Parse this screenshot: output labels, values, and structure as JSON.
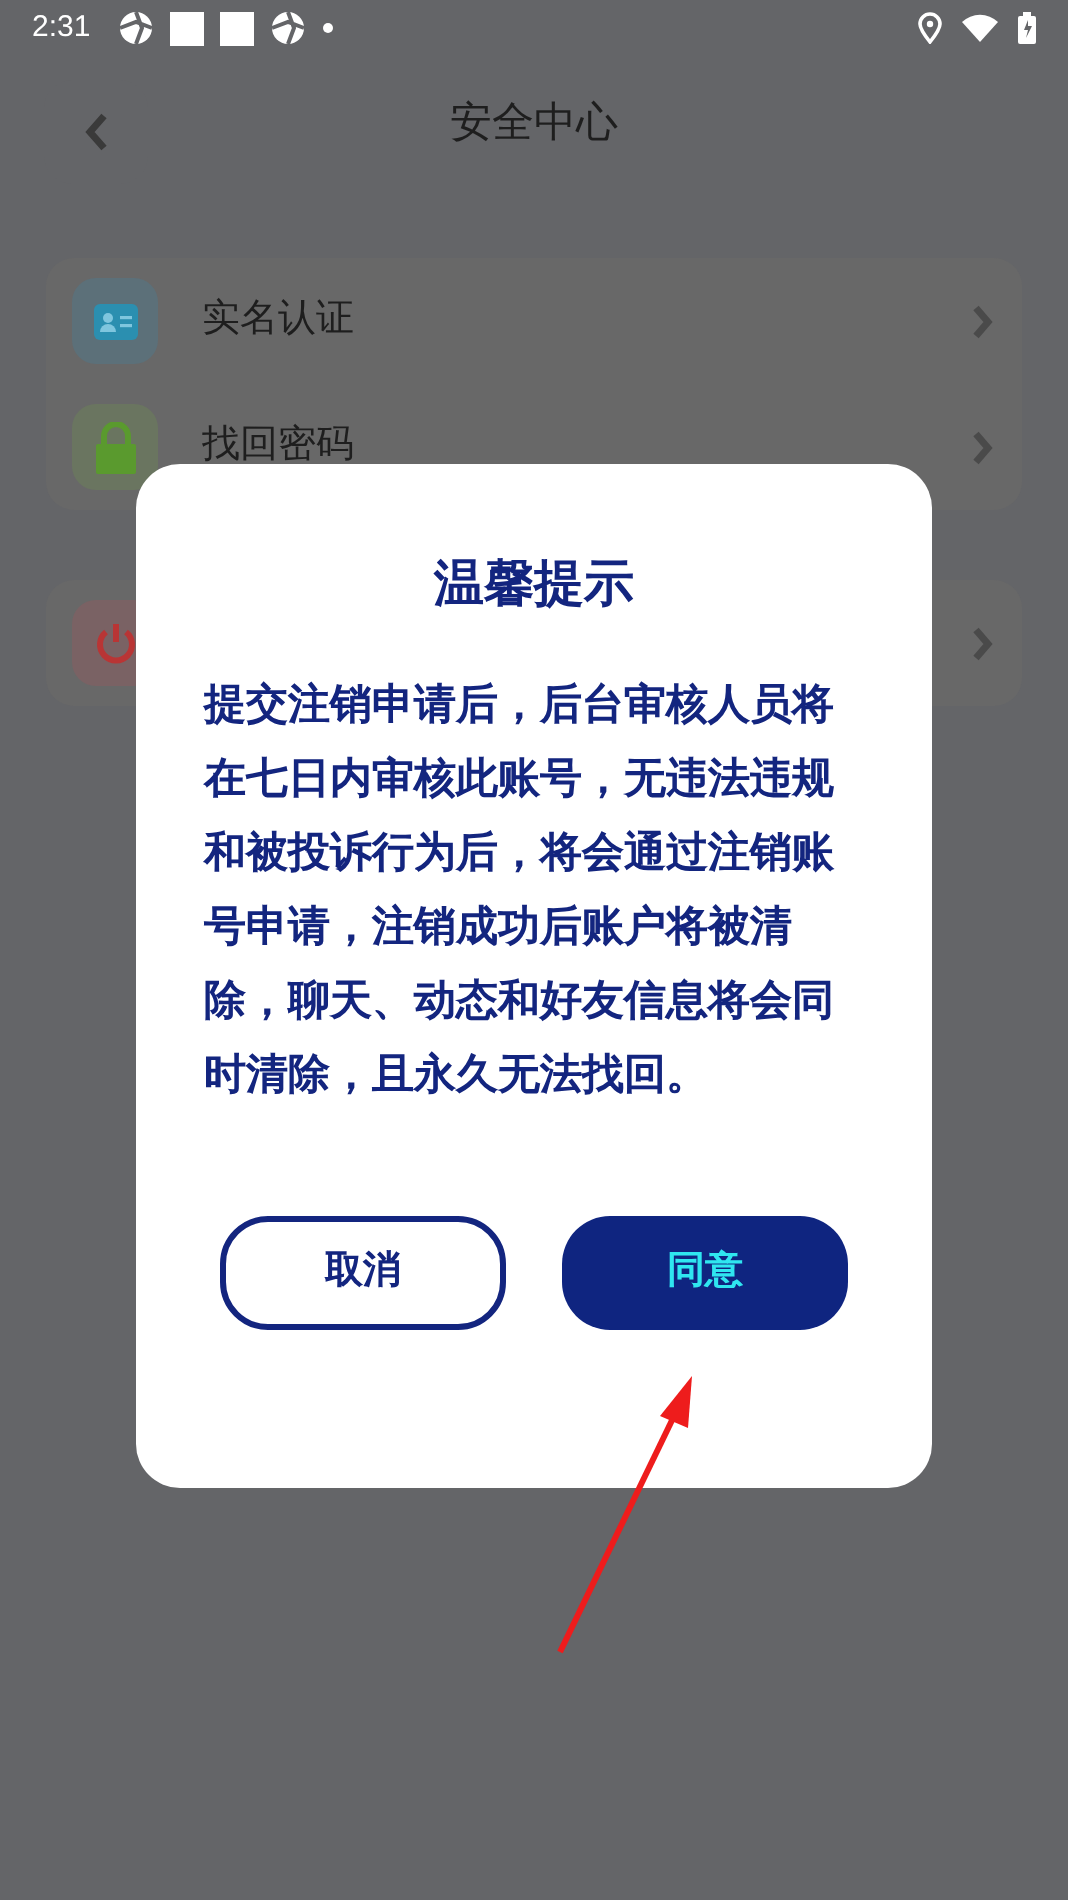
{
  "status_bar": {
    "time": "2:31"
  },
  "header": {
    "title": "安全中心"
  },
  "groups": [
    {
      "items": [
        {
          "kind": "id-card",
          "label": "实名认证"
        },
        {
          "kind": "lock",
          "label": "找回密码"
        }
      ]
    },
    {
      "items": [
        {
          "kind": "power"
        }
      ]
    }
  ],
  "dialog": {
    "title": "温馨提示",
    "message": "提交注销申请后，后台审核人员将在七日内审核此账号，无违法违规和被投诉行为后，将会通过注销账号申请，注销成功后账户将被清除，聊天、动态和好友信息将会同时清除，且永久无法找回。",
    "buttons": [
      {
        "kind": "outline",
        "label": "取消"
      },
      {
        "kind": "filled",
        "label": "同意"
      }
    ]
  }
}
